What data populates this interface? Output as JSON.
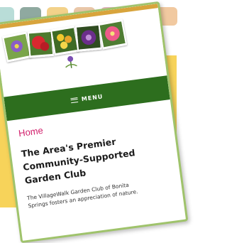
{
  "page": {
    "nav_label": "MENU",
    "breadcrumb": "Home",
    "title_line1": "The Area's Premier",
    "title_line2": "Community-Supported",
    "title_line3": "Garden Club",
    "intro_line1": "The VillageWalk Garden Club of Bonita",
    "intro_line2": "Springs fosters an appreciation of nature."
  },
  "colors": {
    "accent_green": "#2d6e1e",
    "breadcrumb_pink": "#d11d6a",
    "frame_green": "#9fc36b",
    "background_yellow": "#f7d35a"
  },
  "icons": {
    "nav": "hamburger-menu-icon"
  }
}
